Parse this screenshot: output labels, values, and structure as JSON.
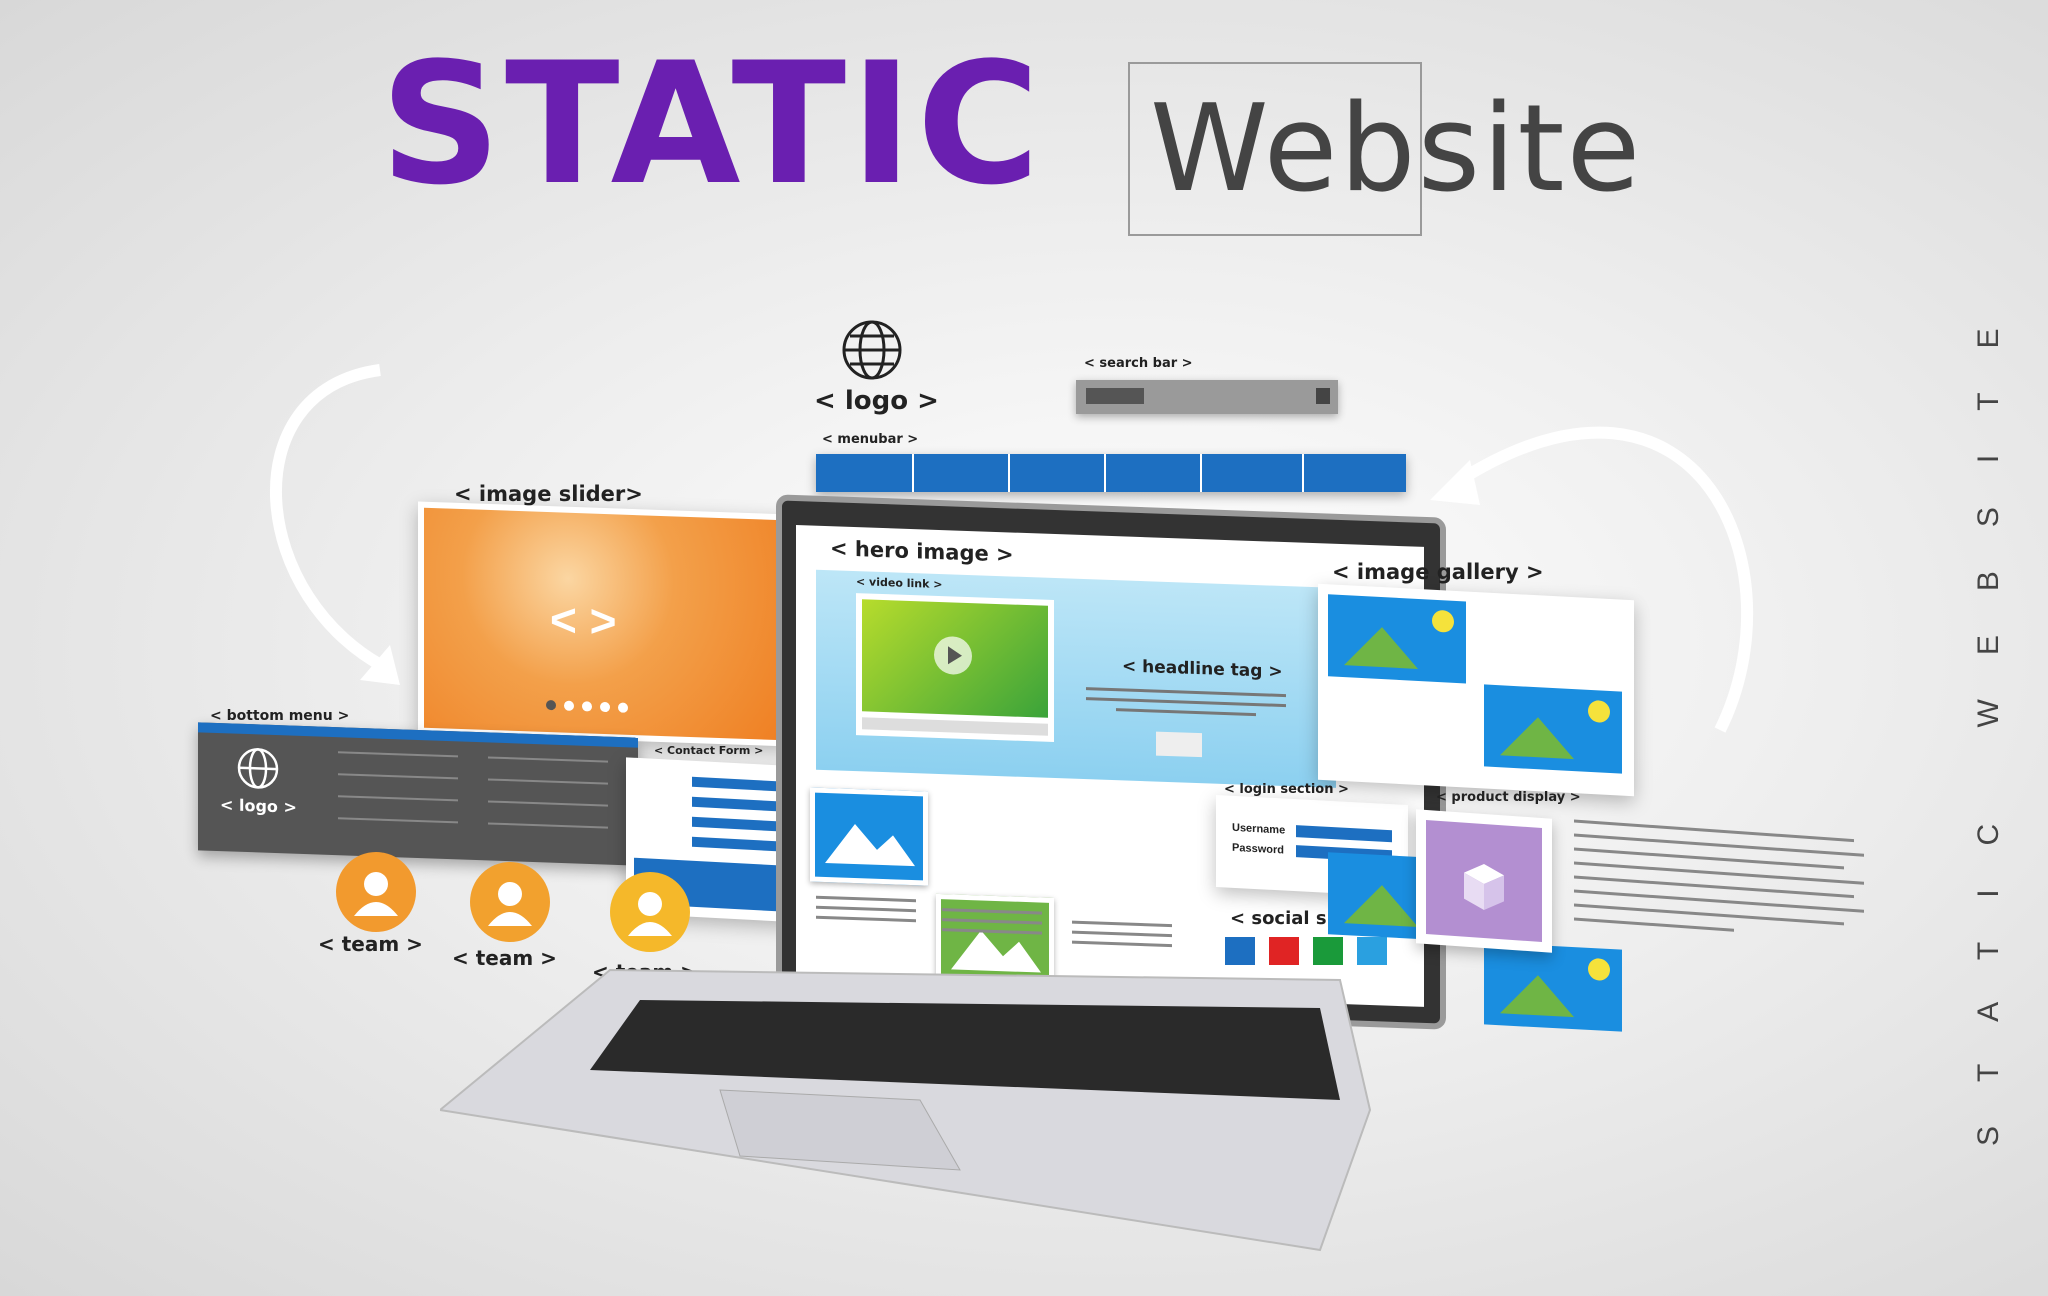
{
  "title": {
    "word1": "STATIC",
    "word2": "Website"
  },
  "side_vertical_text": "STATIC WEBSITE",
  "tags": {
    "logo": "< logo >",
    "search_bar": "< search bar >",
    "menubar": "< menubar >",
    "image_slider": "< image slider>",
    "hero_image": "< hero image >",
    "video_link": "< video link >",
    "image_gallery": "< image gallery >",
    "headline_tag": "< headline tag >",
    "bottom_menu": "< bottom menu >",
    "login_section": "< login section >",
    "product_display": "< product display >",
    "social_share": "< social share >",
    "contact_form": "< Contact Form >",
    "team1": "< team >",
    "team2": "< team >",
    "team3": "< team >",
    "bottom_logo": "< logo >"
  },
  "login": {
    "username": "Username",
    "password": "Password"
  },
  "colors": {
    "title_purple": "#6a1fb0",
    "menubar_blue": "#1d6fc1",
    "slider_orange": "#f08a2c",
    "team_orange": "#f29a2e",
    "team_yellow": "#f5b82a",
    "gallery_blue": "#1a8ee0",
    "hill_green": "#6fb545",
    "product_purple": "#b38fd1",
    "social_colors": [
      "#1d6fc1",
      "#e02424",
      "#1a9a3a",
      "#2aa0e0"
    ]
  },
  "icons": {
    "globe": "globe-icon",
    "arrow": "curved-arrow-icon",
    "play": "play-icon",
    "image": "image-icon",
    "user": "user-icon",
    "box": "box-icon"
  }
}
